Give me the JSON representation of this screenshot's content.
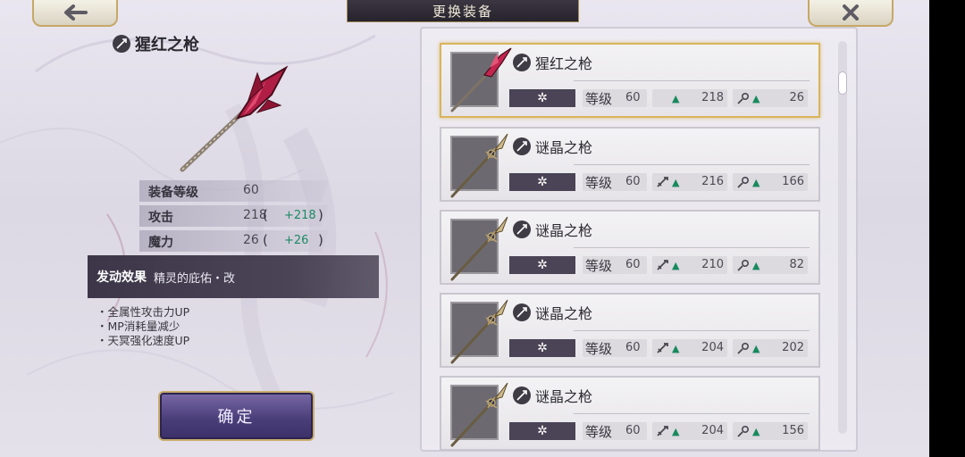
{
  "header": {
    "title": "更换装备",
    "back_icon": "arrow-left-icon",
    "close_icon": "close-x-icon"
  },
  "selected": {
    "name": "猩红之枪",
    "stats": [
      {
        "label": "装备等级",
        "value": "60",
        "bonus": ""
      },
      {
        "label": "攻击",
        "value": "218",
        "bonus": "+218"
      },
      {
        "label": "魔力",
        "value": "26",
        "bonus": "+26"
      }
    ],
    "effect_heading": "发动效果",
    "effect_name": "精灵的庇佑・改",
    "effect_bullets": [
      "・全属性攻击力UP",
      "・MP消耗量减少",
      "・天冥强化速度UP"
    ],
    "confirm_label": "确定"
  },
  "colors": {
    "bonus_green": "#1c8a64",
    "selected_border": "#d9b45c",
    "tag_bg": "#4a4456",
    "crimson": "#c2264e"
  },
  "list": {
    "tag_symbol": "✲",
    "level_label": "等级",
    "items": [
      {
        "name": "猩红之枪",
        "level": "60",
        "atk": "218",
        "mag": "26",
        "selected": true,
        "variant": "crimson"
      },
      {
        "name": "谜晶之枪",
        "level": "60",
        "atk": "216",
        "mag": "166",
        "selected": false,
        "variant": "mystic"
      },
      {
        "name": "谜晶之枪",
        "level": "60",
        "atk": "210",
        "mag": "82",
        "selected": false,
        "variant": "mystic"
      },
      {
        "name": "谜晶之枪",
        "level": "60",
        "atk": "204",
        "mag": "202",
        "selected": false,
        "variant": "mystic"
      },
      {
        "name": "谜晶之枪",
        "level": "60",
        "atk": "204",
        "mag": "156",
        "selected": false,
        "variant": "mystic"
      }
    ]
  }
}
